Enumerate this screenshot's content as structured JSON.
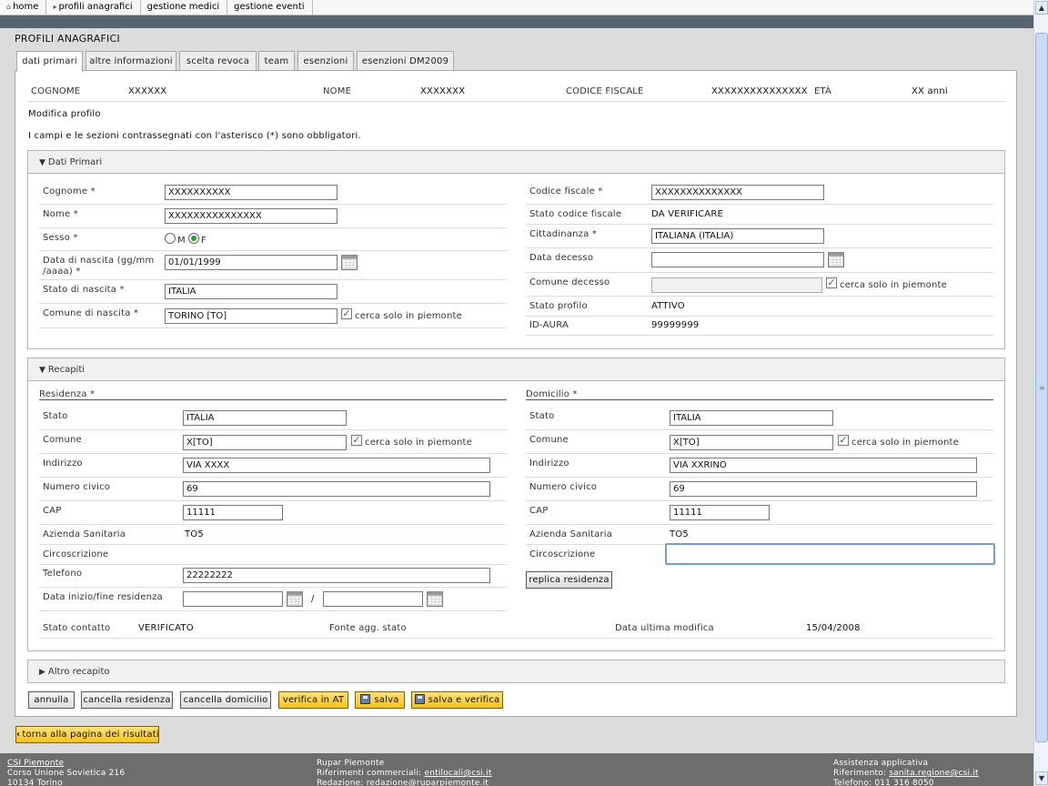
{
  "topnav": {
    "items": [
      "home",
      "profili anagrafici",
      "gestione medici",
      "gestione eventi"
    ]
  },
  "page": {
    "title": "PROFILI ANAGRAFICI"
  },
  "tabs": [
    "dati primari",
    "altre informazioni",
    "scelta revoca",
    "team",
    "esenzioni",
    "esenzioni DM2009"
  ],
  "header": {
    "cognome_label": "COGNOME",
    "cognome_value": "XXXXXX",
    "nome_label": "NOME",
    "nome_value": "XXXXXXX",
    "cf_label": "CODICE FISCALE",
    "cf_value": "XXXXXXXXXXXXXXX",
    "eta_label": "ETÀ",
    "eta_value": "XX anni"
  },
  "intro": {
    "modifica": "Modifica profilo",
    "note": "I campi e le sezioni contrassegnati con l'asterisco (*) sono obbligatori."
  },
  "dati_primari": {
    "title": "Dati Primari",
    "cognome_label": "Cognome *",
    "cognome_value": "XXXXXXXXXX",
    "nome_label": "Nome *",
    "nome_value": "XXXXXXXXXXXXXXX",
    "sesso_label": "Sesso *",
    "sesso_m": "M",
    "sesso_f": "F",
    "sesso_selected": "F",
    "nascita_label_1": "Data di nascita (gg/mm",
    "nascita_label_2": "/aaaa) *",
    "nascita_value": "01/01/1999",
    "stato_nascita_label": "Stato di nascita *",
    "stato_nascita_value": "ITALIA",
    "comune_nascita_label": "Comune di nascita *",
    "comune_nascita_value": "TORINO [TO]",
    "cerca_label": "cerca solo in piemonte",
    "cf_label": "Codice fiscale *",
    "cf_value": "XXXXXXXXXXXXXX",
    "stato_cf_label": "Stato codice fiscale",
    "stato_cf_value": "DA VERIFICARE",
    "cittadinanza_label": "Cittadinanza *",
    "cittadinanza_value": "ITALIANA (ITALIA)",
    "data_decesso_label": "Data decesso",
    "data_decesso_value": "",
    "comune_decesso_label": "Comune decesso",
    "comune_decesso_value": "",
    "stato_profilo_label": "Stato profilo",
    "stato_profilo_value": "ATTIVO",
    "idaura_label": "ID-AURA",
    "idaura_value": "99999999"
  },
  "recapiti": {
    "title": "Recapiti",
    "residenza": {
      "heading": "Residenza *",
      "stato_label": "Stato",
      "stato_value": "ITALIA",
      "comune_label": "Comune",
      "comune_value": "X[TO]",
      "indirizzo_label": "Indirizzo",
      "indirizzo_value": "VIA XXXX",
      "civico_label": "Numero civico",
      "civico_value": "69",
      "cap_label": "CAP",
      "cap_value": "11111",
      "asl_label": "Azienda Sanitaria",
      "asl_value": "TO5",
      "circ_label": "Circoscrizione",
      "tel_label": "Telefono",
      "tel_value": "22222222",
      "date_label": "Data inizio/fine residenza",
      "date_sep": "/",
      "date_start": "",
      "date_end": ""
    },
    "domicilio": {
      "heading": "Domicilio *",
      "stato_label": "Stato",
      "stato_value": "ITALIA",
      "comune_label": "Comune",
      "comune_value": "X[TO]",
      "indirizzo_label": "Indirizzo",
      "indirizzo_value": "VIA XXRINO",
      "civico_label": "Numero civico",
      "civico_value": "69",
      "cap_label": "CAP",
      "cap_value": "11111",
      "asl_label": "Azienda Sanitaria",
      "asl_value": "TO5",
      "circ_label": "Circoscrizione",
      "circ_value": "",
      "replica_button": "replica residenza"
    },
    "cerca_label": "cerca solo in piemonte",
    "stato_contatto_label": "Stato contatto",
    "stato_contatto_value": "VERIFICATO",
    "fonte_label": "Fonte agg. stato",
    "ultima_mod_label": "Data ultima modifica",
    "ultima_mod_value": "15/04/2008"
  },
  "altro": {
    "title": "Altro recapito"
  },
  "actions": {
    "annulla": "annulla",
    "cancella_residenza": "cancella residenza",
    "cancella_domicilio": "cancella domicilio",
    "verifica": "verifica in AT",
    "salva": "salva",
    "salva_verifica": "salva e verifica",
    "torna": "torna alla pagina dei risultati"
  },
  "footer": {
    "col1_title": "CSI Piemonte",
    "col1_line1": "Corso Unione Sovietica 216",
    "col1_line2": "10134 Torino",
    "col2_title": "Rupar Piemonte",
    "col2_line1_label": "Riferimenti commerciali:",
    "col2_line1_link": "entilocali@csi.it",
    "col2_line2_label": "Redazione:",
    "col2_line2_link": "redazione@ruparpiemonte.it",
    "col3_title": "Assistenza applicativa",
    "col3_line1_label": "Riferimento:",
    "col3_line1_link": "sanita.regione@csi.it",
    "col3_line2": "Telefono: 011 316 8050"
  },
  "colors": {
    "dark_bar": "#596470",
    "button_yellow": "#f5c11c",
    "check_green": "#1b8a1b"
  }
}
